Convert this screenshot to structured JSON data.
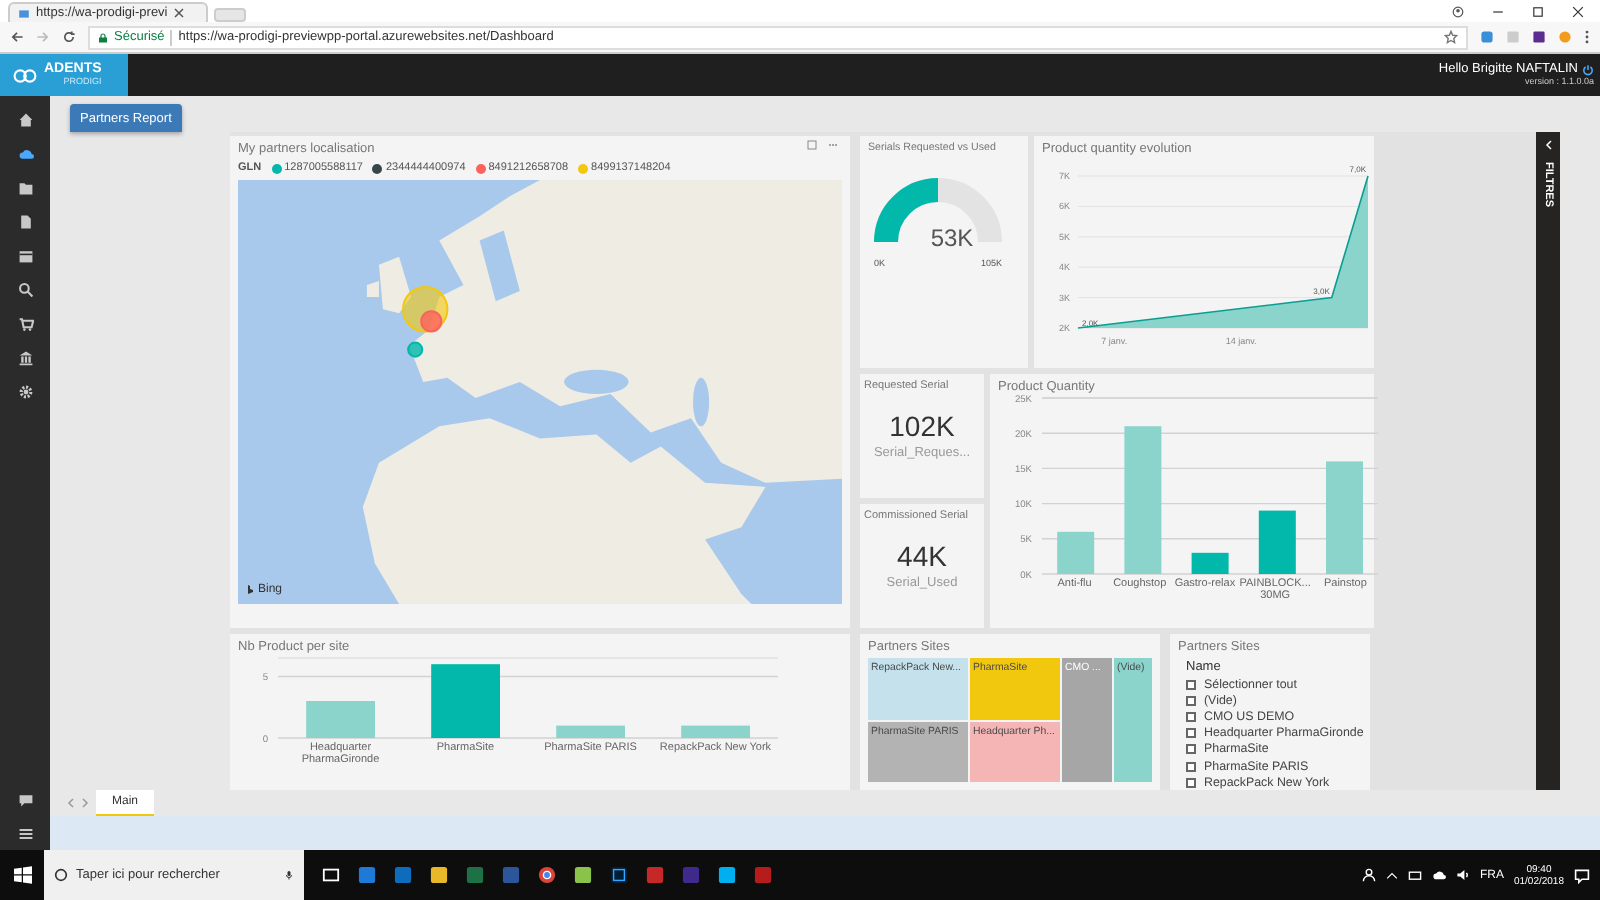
{
  "browser": {
    "tab_title": "https://wa-prodigi-previ",
    "security_label": "Sécurisé",
    "url": "https://wa-prodigi-previewpp-portal.azurewebsites.net/Dashboard"
  },
  "header": {
    "logo": "ADENTS",
    "logo_sub": "PRODIGI",
    "greeting": "Hello Brigitte NAFTALIN",
    "version": "version : 1.1.0.0a"
  },
  "report_tabs": [
    {
      "label": "Partners Report",
      "selected": true
    }
  ],
  "map": {
    "title": "My partners localisation",
    "legend_title": "GLN",
    "legend": [
      {
        "label": "1287005588117",
        "color": "#01b8aa"
      },
      {
        "label": "2344444400974",
        "color": "#374649"
      },
      {
        "label": "8491212658708",
        "color": "#fd625e"
      },
      {
        "label": "8499137148204",
        "color": "#f2c80f"
      }
    ],
    "attribution": "Bing"
  },
  "gauge": {
    "title": "Serials Requested vs Used",
    "value": "53K",
    "min": "0K",
    "max": "105K",
    "level": 0.5
  },
  "evolution": {
    "title": "Product quantity evolution",
    "chart_data": {
      "type": "area",
      "categories": [
        null,
        null,
        "7 janv.",
        null,
        null,
        null,
        null,
        null,
        null,
        "14 janv.",
        null,
        null,
        null,
        null,
        null,
        null,
        null
      ],
      "values": [
        2000,
        null,
        null,
        null,
        null,
        null,
        null,
        null,
        null,
        null,
        null,
        null,
        null,
        null,
        3000,
        null,
        7000
      ],
      "ylim": [
        2000,
        7000
      ],
      "yticks": [
        {
          "value": 2000,
          "label": "2K"
        },
        {
          "value": 3000,
          "label": "3K"
        },
        {
          "value": 4000,
          "label": "4K"
        },
        {
          "value": 5000,
          "label": "5K"
        },
        {
          "value": 6000,
          "label": "6K"
        },
        {
          "value": 7000,
          "label": "7K"
        }
      ],
      "value_labels": [
        "2,0K",
        null,
        null,
        null,
        null,
        null,
        null,
        null,
        null,
        null,
        null,
        null,
        null,
        null,
        "3,0K",
        null,
        "7,0K"
      ],
      "grid": true
    }
  },
  "cards": [
    {
      "title": "Requested Serial",
      "value": "102K",
      "caption": "Serial_Reques..."
    },
    {
      "title": "Commissioned Serial",
      "value": "44K",
      "caption": "Serial_Used"
    }
  ],
  "product_quantity": {
    "title": "Product Quantity",
    "highlighted": [
      false,
      false,
      true,
      true,
      false
    ],
    "chart_data": {
      "type": "bar",
      "grid": true,
      "categories": [
        "Anti-flu",
        "Coughstop",
        "Gastro-relax",
        "PAINBLOCK... 30MG",
        "Painstop"
      ],
      "values": [
        6000,
        21000,
        3000,
        9000,
        16000
      ],
      "ylim": [
        0,
        25000
      ],
      "yticks": [
        {
          "value": 0,
          "label": "0K"
        },
        {
          "value": 5000,
          "label": "5K"
        },
        {
          "value": 10000,
          "label": "10K"
        },
        {
          "value": 15000,
          "label": "15K"
        },
        {
          "value": 20000,
          "label": "20K"
        },
        {
          "value": 25000,
          "label": "25K"
        }
      ]
    }
  },
  "nb_product": {
    "title": "Nb Product per site",
    "highlighted": [
      false,
      true,
      false,
      false
    ],
    "chart_data": {
      "type": "bar",
      "grid": true,
      "categories": [
        "Headquarter PharmaGironde",
        "PharmaSite",
        "PharmaSite PARIS",
        "RepackPack New York"
      ],
      "values": [
        3,
        6,
        1,
        1
      ],
      "ylim": [
        0,
        6.5
      ],
      "yticks": [
        0,
        5
      ]
    }
  },
  "treemap": {
    "title": "Partners Sites",
    "cells": [
      {
        "label": "RepackPack New...",
        "color": "#c4e1ec",
        "kind": "half"
      },
      {
        "label": "PharmaSite PARIS",
        "color": "#b3b3b3",
        "kind": "half"
      },
      {
        "label": "PharmaSite",
        "color": "#f2c80f",
        "kind": "half"
      },
      {
        "label": "Headquarter Ph...",
        "color": "#f5b5b5",
        "kind": "half"
      },
      {
        "label": "CMO ...",
        "color": "#a6a6a6",
        "kind": "tall"
      },
      {
        "label": "(Vide)",
        "color": "#8ad4cc",
        "kind": "tall"
      }
    ]
  },
  "slicer": {
    "title": "Partners Sites",
    "header": "Name",
    "items": [
      {
        "label": "Sélectionner tout",
        "checked": false
      },
      {
        "label": "(Vide)",
        "checked": false
      },
      {
        "label": "CMO US DEMO",
        "checked": false
      },
      {
        "label": "Headquarter PharmaGironde",
        "checked": false
      },
      {
        "label": "PharmaSite",
        "checked": false
      },
      {
        "label": "PharmaSite PARIS",
        "checked": false
      },
      {
        "label": "RepackPack New York",
        "checked": false
      }
    ]
  },
  "filters": {
    "label": "FILTRES"
  },
  "page_tabs": [
    {
      "label": "Main",
      "selected": true
    }
  ],
  "taskbar": {
    "search_placeholder": "Taper ici pour rechercher",
    "language": "FRA",
    "time": "09:40",
    "date": "01/02/2018"
  }
}
